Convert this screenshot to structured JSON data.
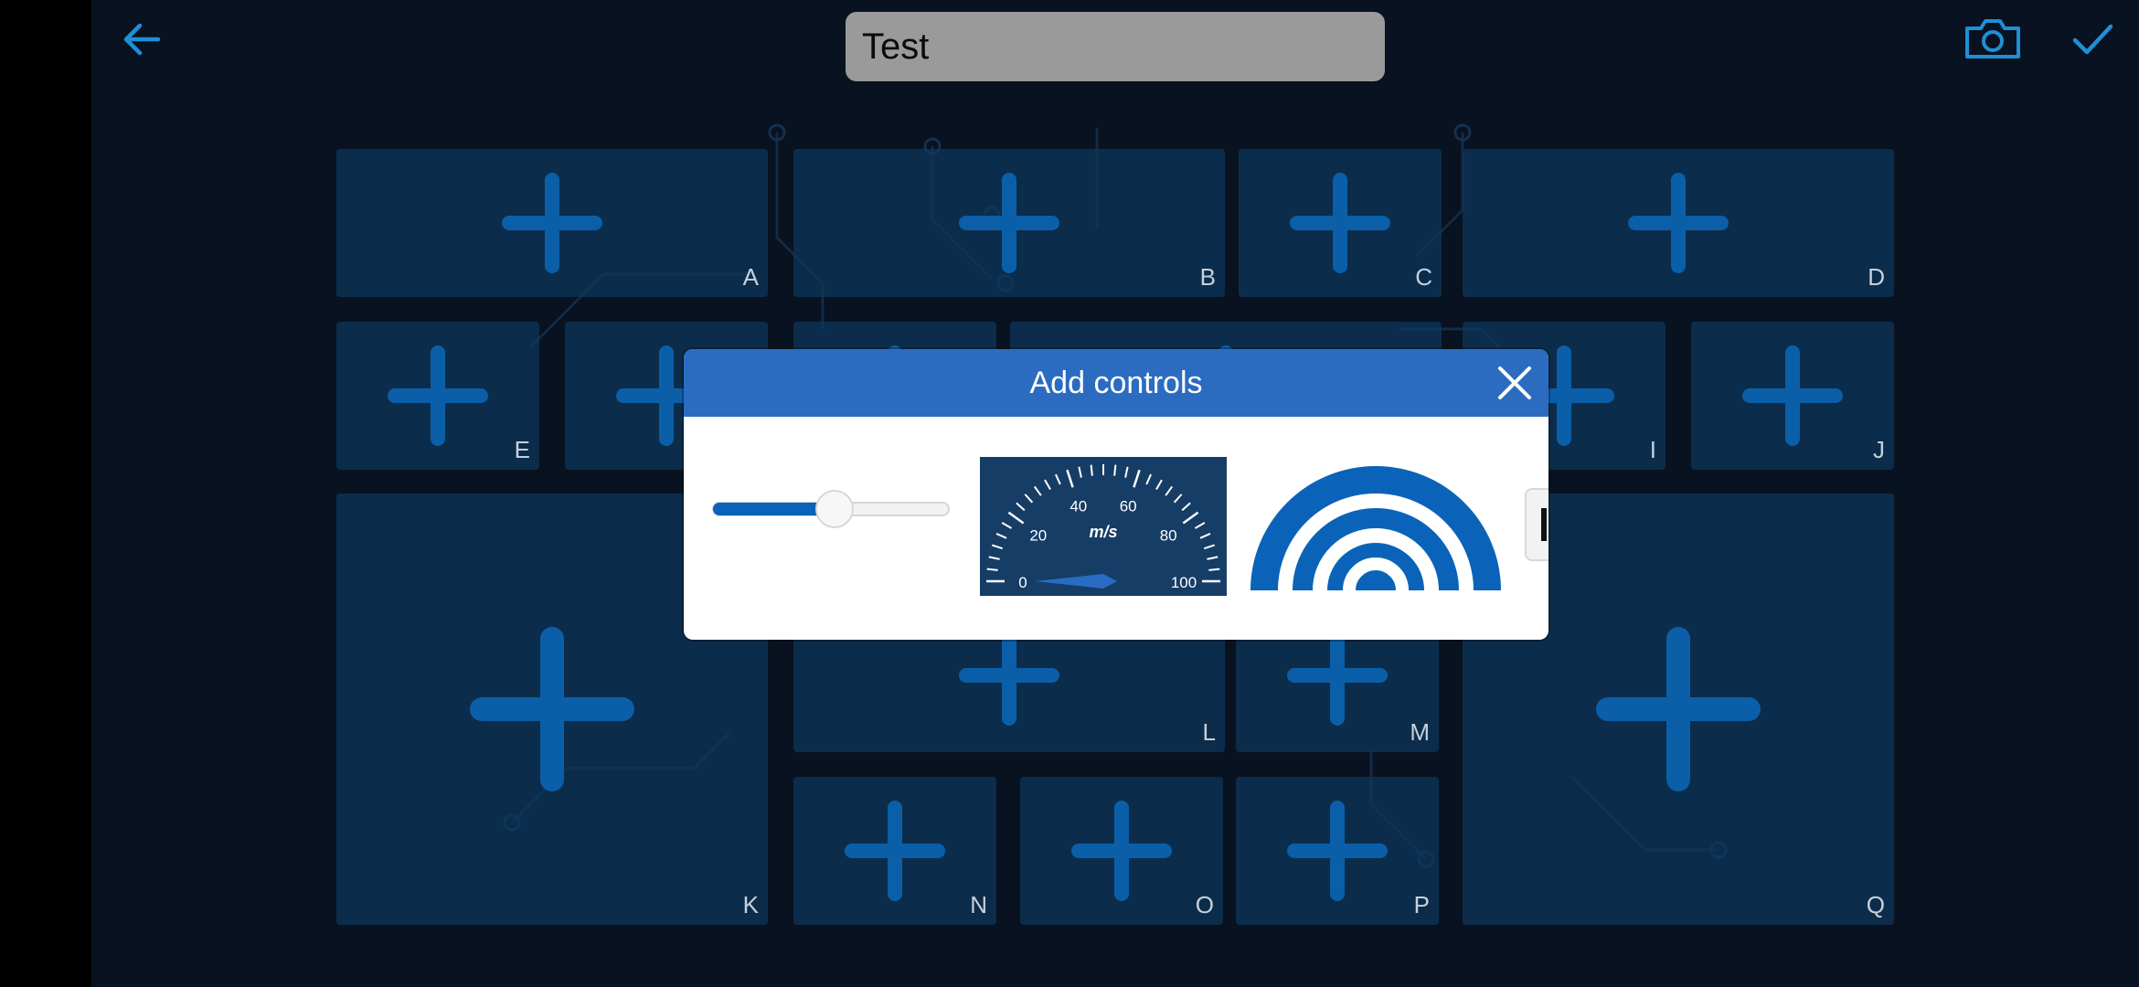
{
  "topbar": {
    "title_value": "Test",
    "back_icon": "arrow-left-icon",
    "camera_icon": "camera-icon",
    "confirm_icon": "checkmark-icon"
  },
  "colors": {
    "screen_bg": "#091220",
    "tile_bg": "#0c375c",
    "plus": "#0b5fa8",
    "accent": "#1f8fd6",
    "dialog_header": "#2b6cc0",
    "title_input_bg": "#9a9a9a"
  },
  "tiles": [
    {
      "id": "A",
      "label": "A",
      "icon": "plus-icon"
    },
    {
      "id": "B",
      "label": "B",
      "icon": "plus-icon"
    },
    {
      "id": "C",
      "label": "C",
      "icon": "plus-icon"
    },
    {
      "id": "D",
      "label": "D",
      "icon": "plus-icon"
    },
    {
      "id": "E",
      "label": "E",
      "icon": "plus-icon"
    },
    {
      "id": "F",
      "label": "",
      "icon": "plus-icon"
    },
    {
      "id": "G",
      "label": "",
      "icon": "plus-icon"
    },
    {
      "id": "H",
      "label": "",
      "icon": "plus-icon"
    },
    {
      "id": "I",
      "label": "I",
      "icon": "plus-icon"
    },
    {
      "id": "J",
      "label": "J",
      "icon": "plus-icon"
    },
    {
      "id": "K",
      "label": "K",
      "icon": "plus-icon"
    },
    {
      "id": "L",
      "label": "L",
      "icon": "plus-icon"
    },
    {
      "id": "M",
      "label": "M",
      "icon": "plus-icon"
    },
    {
      "id": "N",
      "label": "N",
      "icon": "plus-icon"
    },
    {
      "id": "O",
      "label": "O",
      "icon": "plus-icon"
    },
    {
      "id": "P",
      "label": "P",
      "icon": "plus-icon"
    },
    {
      "id": "Q",
      "label": "Q",
      "icon": "plus-icon"
    }
  ],
  "dialog": {
    "title": "Add controls",
    "close_icon": "close-icon",
    "slider": {
      "value_fraction": 0.5
    },
    "speedometer": {
      "unit": "m/s",
      "tick_labels": [
        "0",
        "20",
        "40",
        "60",
        "80",
        "100"
      ],
      "needle_value": 0
    },
    "signal_gauge": {
      "icon": "signal-arcs-icon"
    }
  }
}
